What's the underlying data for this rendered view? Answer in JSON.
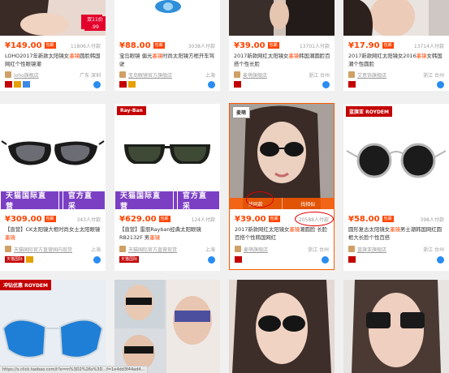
{
  "status_url": "https://s.click.taobao.com/t?e=m%3D2%26s%3D...f=1e4dd3f44ad4...",
  "row1": [
    {
      "price": "¥149.00",
      "baoyou": "包邮",
      "paid": "11806人付款",
      "title_a": "LOHO2017年新款太阳镜女",
      "title_hot": "墨镜",
      "title_b": "圆脸韩国网红个性眼镜潮",
      "shop": "loho旗舰店",
      "loc": "广东 深圳",
      "corner_text": "双11价 .99"
    },
    {
      "price": "¥88.00",
      "baoyou": "包邮",
      "paid": "3038人付款",
      "title_a": "宝岛眼镜 偏光",
      "title_hot": "墨镜",
      "title_b": "时尚太阳镜方框开车驾驶",
      "shop": "宝岛眼镜官方旗舰店",
      "loc": "上海"
    },
    {
      "price": "¥39.00",
      "baoyou": "包邮",
      "paid": "13701人付款",
      "title_a": "2017新款网红太阳镜女",
      "title_hot": "墨镜",
      "title_b": "韩国潮圆脸百搭个性长脸",
      "shop": "麦萌旗舰店",
      "loc": "浙江 台州"
    },
    {
      "price": "¥17.90",
      "baoyou": "包邮",
      "paid": "13714人付款",
      "title_a": "2017新款网红太阳镜女2016",
      "title_hot": "墨镜",
      "title_b": "女韩国潮个性圆脸",
      "shop": "艾意饰旗舰店",
      "loc": "浙江 台州"
    }
  ],
  "row2": [
    {
      "price": "¥309.00",
      "baoyou": "包邮",
      "paid": "343人付款",
      "title_a": "【直营】CK太阳镜大框时尚女士太阳眼镜",
      "title_hot": "墨镜",
      "title_b": "",
      "shop": "天猫国际官方直营国内现货",
      "loc": "上海",
      "banner_a": "天猫国际直营",
      "banner_b": "官方直采"
    },
    {
      "price": "¥629.00",
      "baoyou": "包邮",
      "paid": "124人付款",
      "title_a": "【直营】雷朋Rayban经典太阳眼镜RB2132F 男",
      "title_hot": "墨镜",
      "title_b": "",
      "shop": "天猫国际官方直营现货",
      "loc": "上海",
      "logo": "Ray-Ban",
      "banner_a": "天猫国际直营",
      "banner_b": "官方直采"
    },
    {
      "price": "¥39.00",
      "baoyou": "包邮",
      "paid": "20588人付款",
      "title_a": "2017新款网红太阳镜女",
      "title_hot": "墨镜",
      "title_b": "潮圆脸 长脸百搭个性韩国网红",
      "shop": "麦萌旗舰店",
      "loc": "浙江 台州",
      "overlay_a": "找同款",
      "overlay_b": "找相似",
      "brand": "麦萌"
    },
    {
      "price": "¥58.00",
      "baoyou": "包邮",
      "paid": "398人付款",
      "title_a": "圆形复古太阳镜女",
      "title_hot": "墨镜",
      "title_b": "男士潮韩国网红圆框大长脸个性百搭",
      "shop": "蓝旗亚旗舰店",
      "loc": "浙江 台州",
      "logo": "蓝旗亚 ROYDEM"
    }
  ],
  "row3": [
    {
      "tag": "冲钻优惠 ROYDEM"
    },
    {},
    {},
    {}
  ],
  "colors": {
    "accent": "#ff4400",
    "tmall": "#c40000",
    "purple_banner": "#7b3fc4"
  }
}
